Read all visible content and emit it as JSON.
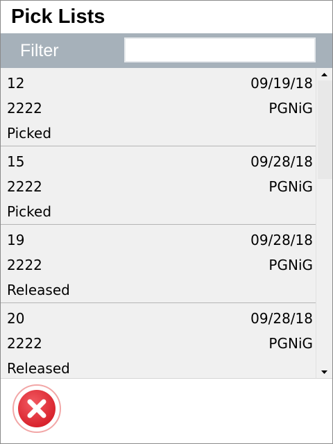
{
  "header": {
    "title": "Pick Lists"
  },
  "filter": {
    "label": "Filter",
    "value": ""
  },
  "list": {
    "items": [
      {
        "number": "12",
        "date": "09/19/18",
        "code": "2222",
        "org": "PGNiG",
        "status": "Picked"
      },
      {
        "number": "15",
        "date": "09/28/18",
        "code": "2222",
        "org": "PGNiG",
        "status": "Picked"
      },
      {
        "number": "19",
        "date": "09/28/18",
        "code": "2222",
        "org": "PGNiG",
        "status": "Released"
      },
      {
        "number": "20",
        "date": "09/28/18",
        "code": "2222",
        "org": "PGNiG",
        "status": "Released"
      }
    ]
  },
  "icons": {
    "cancel": "close-circle-icon",
    "scroll_up": "arrow-up-icon",
    "scroll_down": "arrow-down-icon"
  },
  "colors": {
    "filter_bar": "#a6b1ba",
    "cancel_red": "#e0323c",
    "list_bg": "#f0f0f0"
  }
}
